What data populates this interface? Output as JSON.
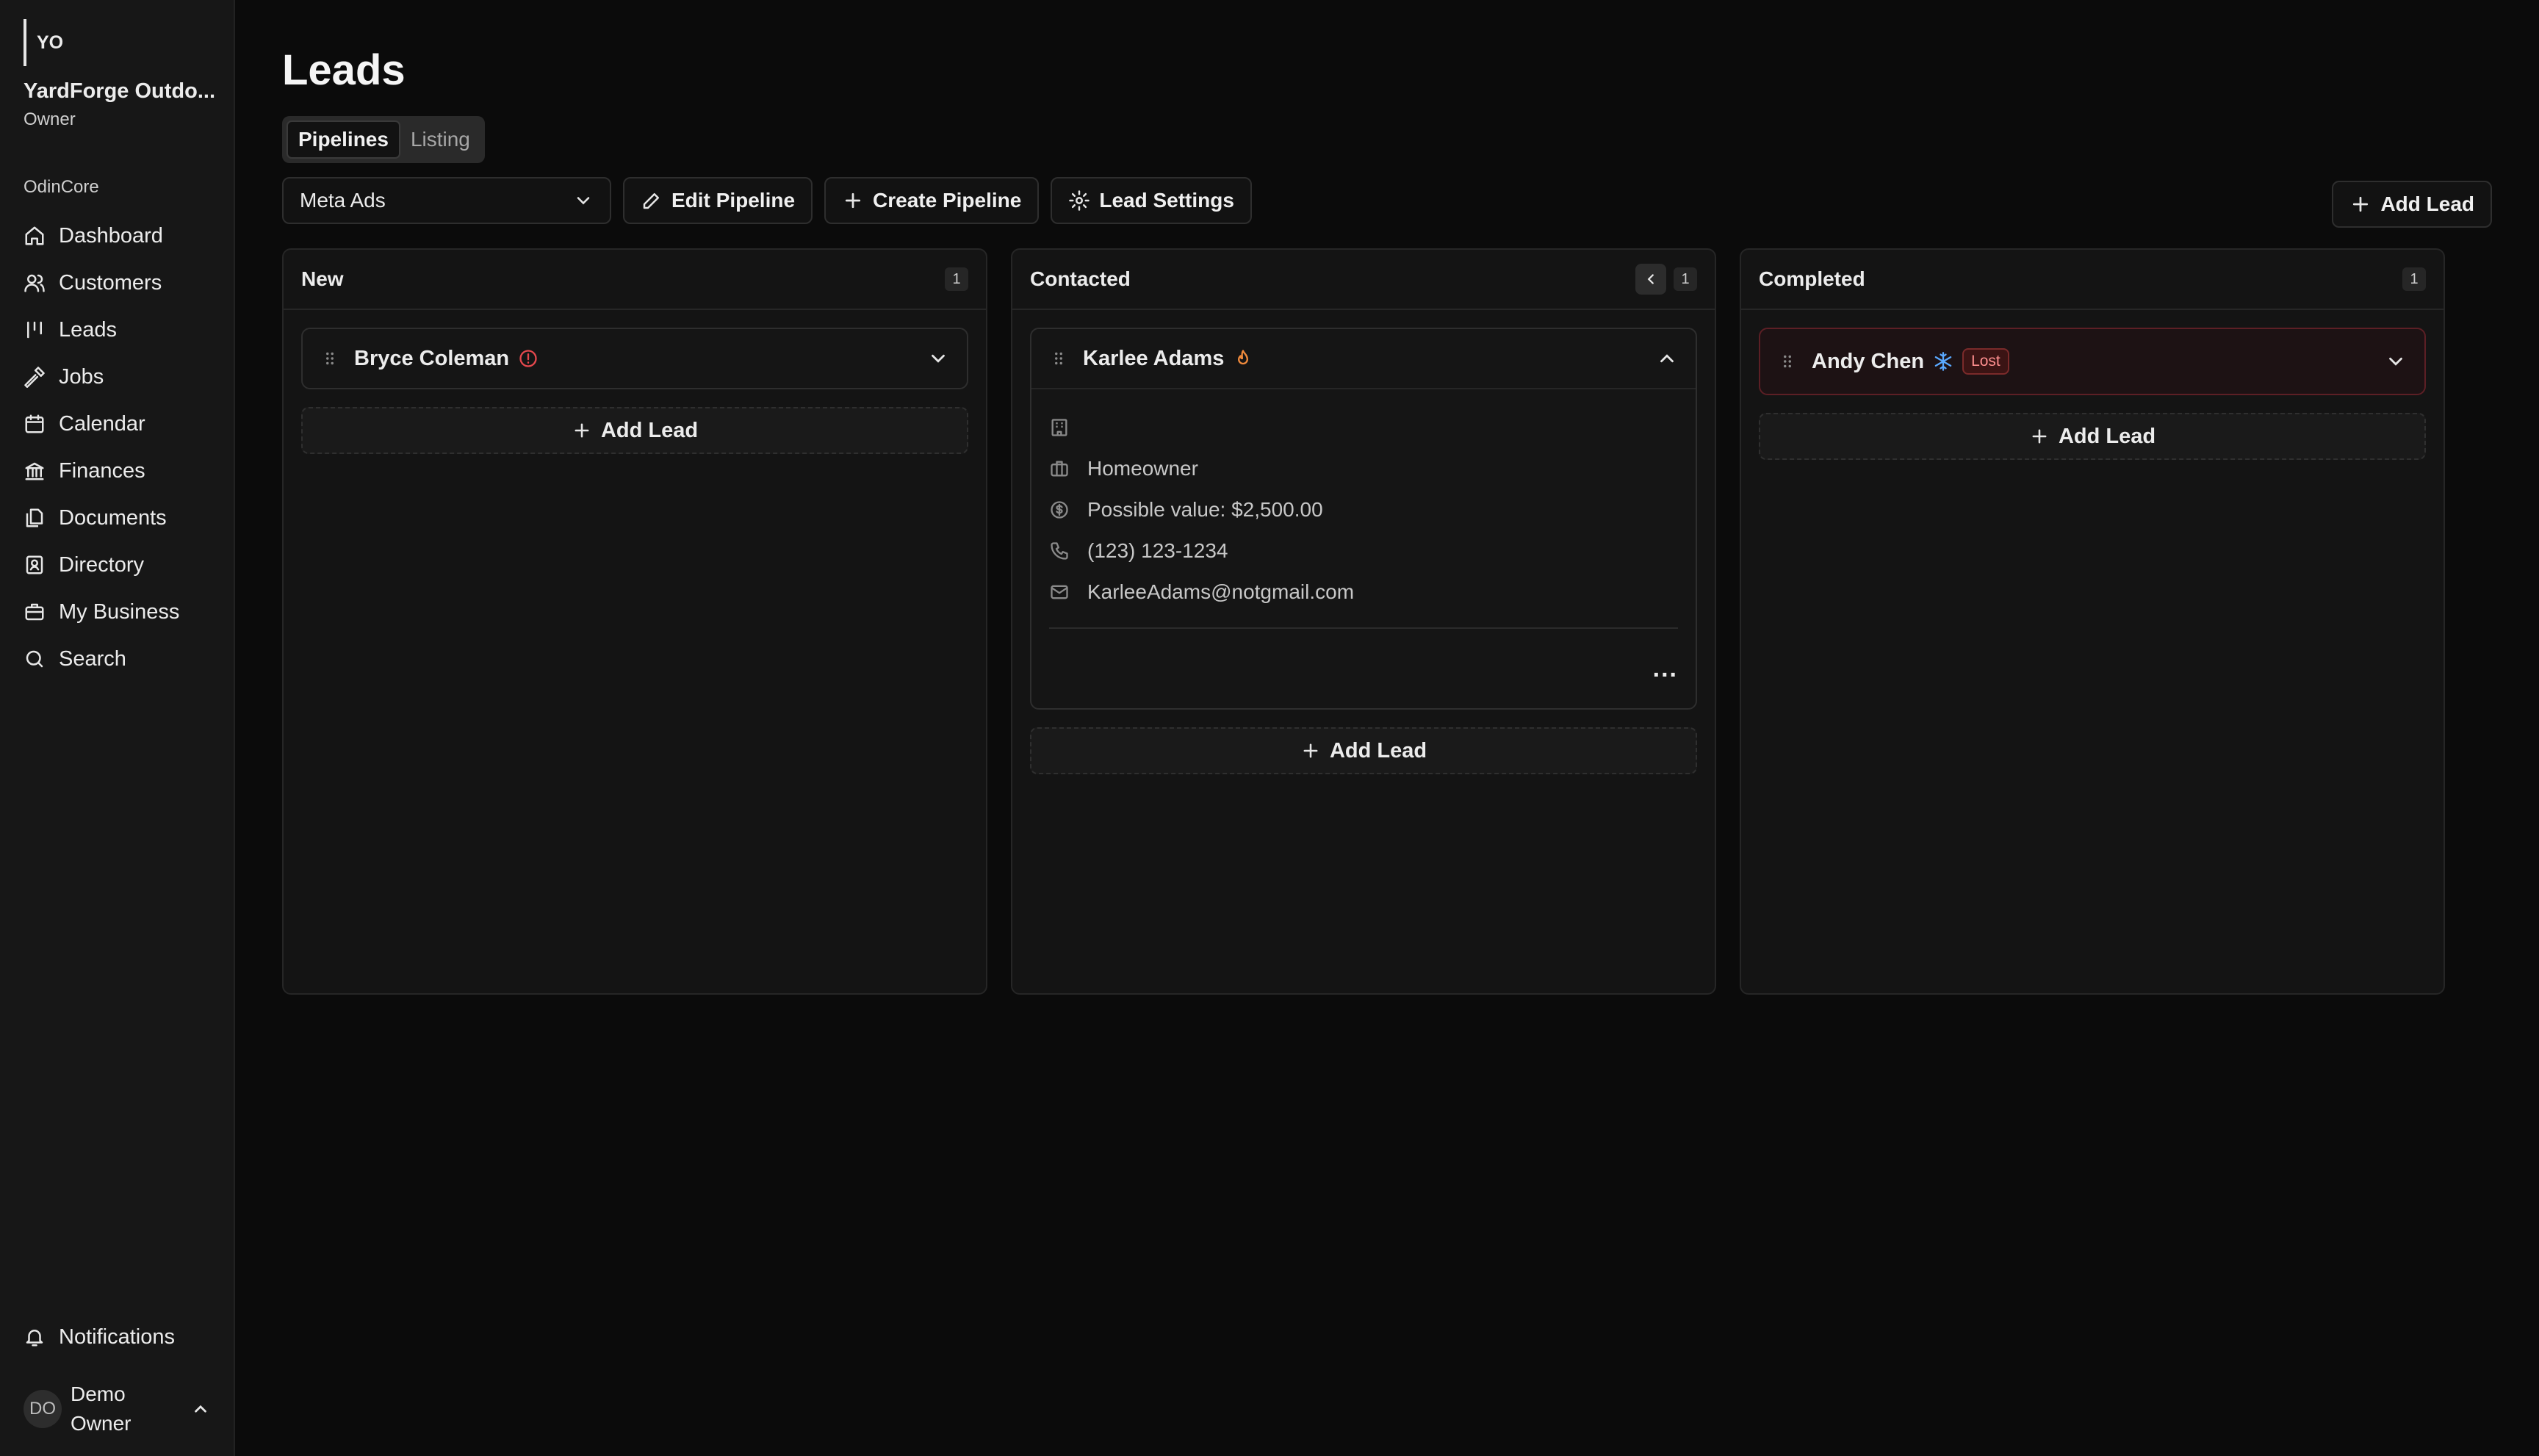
{
  "sidebar": {
    "org_initials": "YO",
    "org_name": "YardForge Outdo...",
    "org_role": "Owner",
    "section_label": "OdinCore",
    "items": [
      {
        "label": "Dashboard",
        "icon": "home-icon"
      },
      {
        "label": "Customers",
        "icon": "users-icon"
      },
      {
        "label": "Leads",
        "icon": "kanban-icon"
      },
      {
        "label": "Jobs",
        "icon": "hammer-icon"
      },
      {
        "label": "Calendar",
        "icon": "calendar-icon"
      },
      {
        "label": "Finances",
        "icon": "bank-icon"
      },
      {
        "label": "Documents",
        "icon": "files-icon"
      },
      {
        "label": "Directory",
        "icon": "contact-book-icon"
      },
      {
        "label": "My Business",
        "icon": "briefcase-icon"
      },
      {
        "label": "Search",
        "icon": "search-icon"
      }
    ],
    "notifications_label": "Notifications",
    "user": {
      "initials": "DO",
      "name": "Demo Owner"
    }
  },
  "header": {
    "title": "Leads",
    "tabs": [
      {
        "label": "Pipelines",
        "active": true
      },
      {
        "label": "Listing",
        "active": false
      }
    ]
  },
  "toolbar": {
    "pipeline_select": "Meta Ads",
    "edit_pipeline": "Edit Pipeline",
    "create_pipeline": "Create Pipeline",
    "lead_settings": "Lead Settings",
    "add_lead": "Add Lead"
  },
  "columns": [
    {
      "title": "New",
      "count": "1",
      "lead": {
        "name": "Bryce Coleman",
        "status_icon": "alert-circle-icon"
      },
      "add_lead": "Add Lead"
    },
    {
      "title": "Contacted",
      "count": "1",
      "lead": {
        "name": "Karlee Adams",
        "status_icon": "flame-icon",
        "company": "",
        "type": "Homeowner",
        "value": "Possible value: $2,500.00",
        "phone": "(123) 123-1234",
        "email": "KarleeAdams@notgmail.com",
        "more": "..."
      },
      "add_lead": "Add Lead"
    },
    {
      "title": "Completed",
      "count": "1",
      "lead": {
        "name": "Andy Chen",
        "status_icon": "snowflake-icon",
        "badge": "Lost"
      },
      "add_lead": "Add Lead"
    }
  ],
  "colors": {
    "accent_flame": "#f08a3c",
    "accent_alert": "#e5484d",
    "accent_snow": "#5aa9ff",
    "lost": "#ff8f8f"
  }
}
